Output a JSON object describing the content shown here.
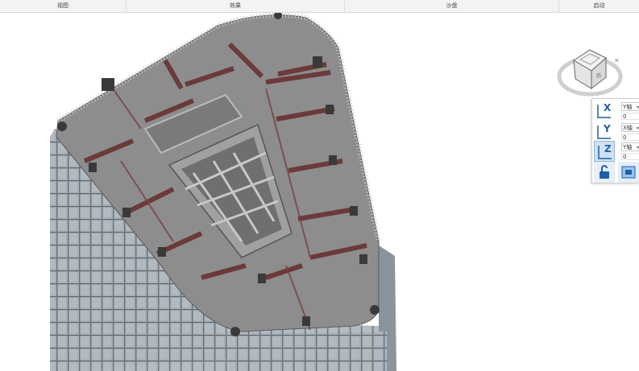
{
  "menu_tabs": [
    {
      "label": "视图"
    },
    {
      "label": "效果"
    },
    {
      "label": "沙盘"
    },
    {
      "label": "启动"
    }
  ],
  "viewcube": {
    "face_label": "后",
    "icon": "viewcube-icon"
  },
  "axis_tools": [
    {
      "axis": "X",
      "select": "Y轴",
      "value": "0",
      "icon": "x-axis-icon",
      "active": false
    },
    {
      "axis": "Y",
      "select": "X轴",
      "value": "0",
      "icon": "y-axis-icon",
      "active": false
    },
    {
      "axis": "Z",
      "select": "Y轴",
      "value": "0",
      "icon": "z-axis-icon",
      "active": true
    }
  ],
  "bottom_tools": [
    {
      "icon": "unlock-icon"
    },
    {
      "icon": "section-box-icon"
    }
  ],
  "colors": {
    "slab": "#8d8d8d",
    "beam": "#6b3a3a",
    "facade": "#9aa3ab",
    "accent": "#1f5fa8"
  }
}
